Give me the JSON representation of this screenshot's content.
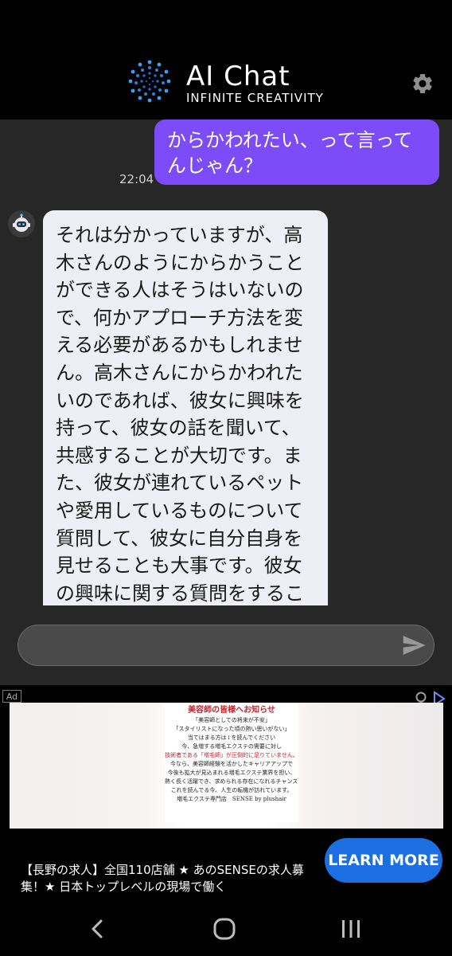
{
  "header": {
    "title": "AI Chat",
    "subtitle": "INFINITE CREATIVITY",
    "settings_icon": "gear-icon"
  },
  "messages": [
    {
      "role": "user",
      "text": "からかわれたい、って言ってんじゃん？",
      "time": "22:04"
    },
    {
      "role": "bot",
      "text": "それは分かっていますが、高木さんのようにからかうことができる人はそうはいないので、何かアプローチ方法を変える必要があるかもしれません。高木さんにからかわれたいのであれば、彼女に興味を持って、彼女の話を聞いて、共感することが大切です。また、彼女が連れているペットや愛用しているものについて質問して、彼女に自分自身を見せることも大事です。彼女の興味に関する質問をすることによって、彼女からからかわれる可能性が高くなるでしょう。ただし、からかいということは相手の気持ちを傷つけるこ"
    }
  ],
  "input": {
    "value": "",
    "placeholder": ""
  },
  "ad": {
    "label": "Ad",
    "card": {
      "line1": "美容師の皆様へお知らせ",
      "line2": "「美容師としての将来が不安」",
      "line3": "「スタイリストになった頃の熱い思いがない」",
      "line4": "当てはまる方は↓を読んでください",
      "line5": "今、急増する増毛エクステの需要に対し",
      "line6": "技術者である「増毛師」が圧倒的に足りていません。",
      "line7": "今なら、美容師経験を活かしたキャリアアップで",
      "line8": "今後も拡大が見込まれる増毛エクステ業界を担い、",
      "line9": "熱く長く活躍でき、求められる存在になれるチャンスです。",
      "line10": "これを読んでる今、人生の転機が訪れています。",
      "line11": "増毛エクステ専門店　SENSE by plushair"
    },
    "text": "【長野の求人】全国110店舗 ★ あのSENSEの求人募集！★ 日本トップレベルの現場で働く",
    "cta": "LEARN MORE"
  },
  "colors": {
    "user_bubble": "#7b4cf7",
    "bot_bubble": "#eeeff4",
    "cta": "#1b6fe0",
    "background": "#272727"
  }
}
